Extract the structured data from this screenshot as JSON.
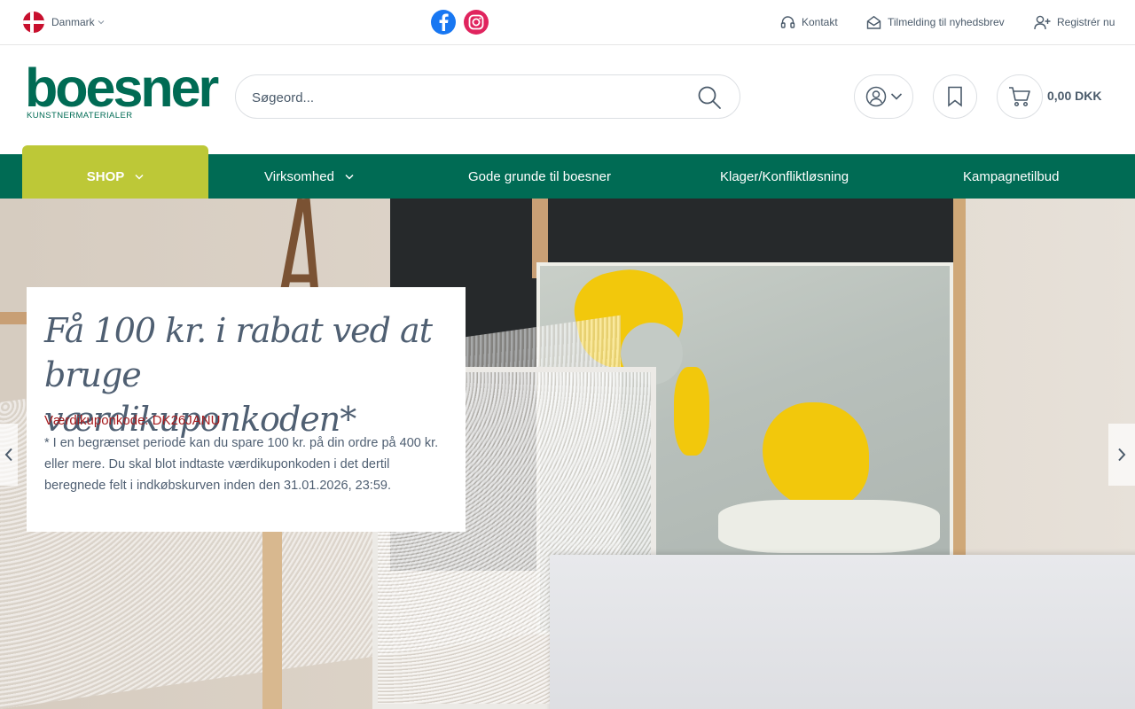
{
  "topbar": {
    "country": "Danmark",
    "links": {
      "contact": "Kontakt",
      "newsletter": "Tilmelding til nyhedsbrev",
      "register": "Registrér nu"
    }
  },
  "header": {
    "logo_word": "boesner",
    "logo_sub": "KUNSTNERMATERIALER",
    "search_placeholder": "Søgeord...",
    "cart_total": "0,00 DKK"
  },
  "nav": {
    "shop": "SHOP",
    "business": "Virksomhed",
    "reasons": "Gode grunde til boesner",
    "complaints": "Klager/Konfliktløsning",
    "campaigns": "Kampagnetilbud"
  },
  "hero": {
    "title": "Få 100 kr. i rabat ved at bruge værdikuponkoden*",
    "code_line": "Værdikuponkode: DK26JANU",
    "body": "* I en begrænset periode kan du spare 100 kr. på din ordre på 400 kr. eller mere. Du skal blot indtaste værdikuponkoden i det dertil beregnede felt i indkøbskurven inden den 31.01.2026, 23:59."
  },
  "colors": {
    "brand_green": "#006b54",
    "shop_lime": "#bdc837",
    "code_red": "#a51c1f"
  }
}
